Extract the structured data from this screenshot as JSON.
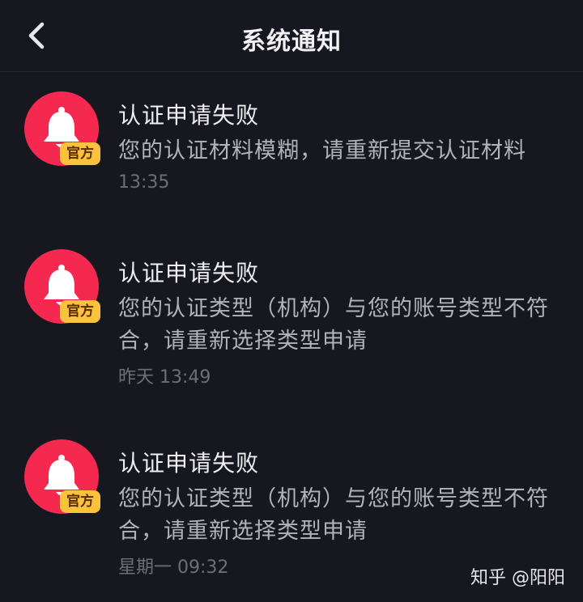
{
  "header": {
    "title": "系统通知",
    "back_icon": "chevron-left-icon"
  },
  "notifications": [
    {
      "icon": "bell-icon",
      "badge": "官方",
      "title": "认证申请失败",
      "body": "您的认证材料模糊，请重新提交认证材料",
      "time": "13:35"
    },
    {
      "icon": "bell-icon",
      "badge": "官方",
      "title": "认证申请失败",
      "body": "您的认证类型（机构）与您的账号类型不符合，请重新选择类型申请",
      "time": "昨天 13:49"
    },
    {
      "icon": "bell-icon",
      "badge": "官方",
      "title": "认证申请失败",
      "body": "您的认证类型（机构）与您的账号类型不符合，请重新选择类型申请",
      "time": "星期一 09:32"
    }
  ],
  "watermark": "知乎 @阳阳",
  "colors": {
    "background": "#17171f",
    "avatar": "#f5294f",
    "badge": "#fbc23b"
  }
}
